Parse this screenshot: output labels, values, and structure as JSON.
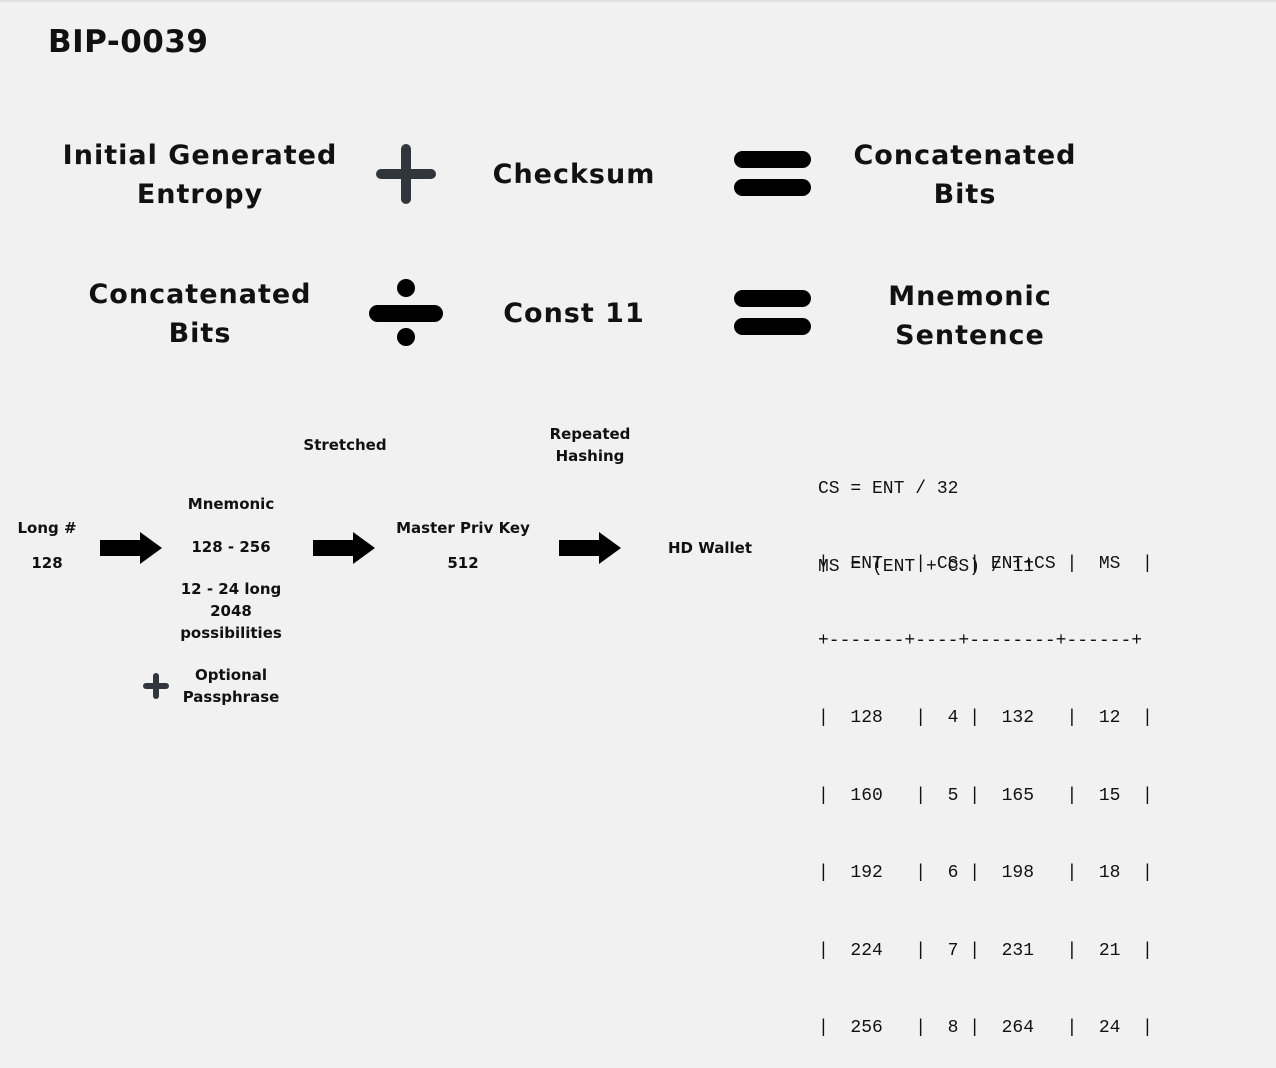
{
  "title": "BIP-0039",
  "equations": [
    {
      "left": [
        "Initial Generated",
        "Entropy"
      ],
      "operator": "plus",
      "middle": "Checksum",
      "result": [
        "Concatenated",
        "Bits"
      ]
    },
    {
      "left": [
        "Concatenated",
        "Bits"
      ],
      "operator": "divide",
      "middle": "Const 11",
      "result": [
        "Mnemonic",
        "Sentence"
      ]
    }
  ],
  "flow": {
    "long": {
      "label": "Long #",
      "value": "128"
    },
    "mnemonic": {
      "label": "Mnemonic",
      "range": "128 -  256",
      "length": "12 - 24 long",
      "count": "2048",
      "possibilities": "possibilities"
    },
    "stretched": "Stretched",
    "master": {
      "label": "Master Priv Key",
      "value": "512"
    },
    "repeated": [
      "Repeated",
      "Hashing"
    ],
    "wallet": "HD Wallet",
    "optional": [
      "Optional",
      "Passphrase"
    ]
  },
  "formulas": [
    "CS = ENT / 32",
    "MS = (ENT + CS) / 11"
  ],
  "table": {
    "header": "|  ENT   | CS | ENT+CS |  MS  |",
    "separator": "+-------+----+--------+------+",
    "rows": [
      "|  128   |  4 |  132   |  12  |",
      "|  160   |  5 |  165   |  15  |",
      "|  192   |  6 |  198   |  18  |",
      "|  224   |  7 |  231   |  21  |",
      "|  256   |  8 |  264   |  24  |"
    ]
  },
  "colors": {
    "plus": "#30363b",
    "equals": "#000000",
    "arrow": "#000000",
    "background": "#f1f1f1"
  }
}
